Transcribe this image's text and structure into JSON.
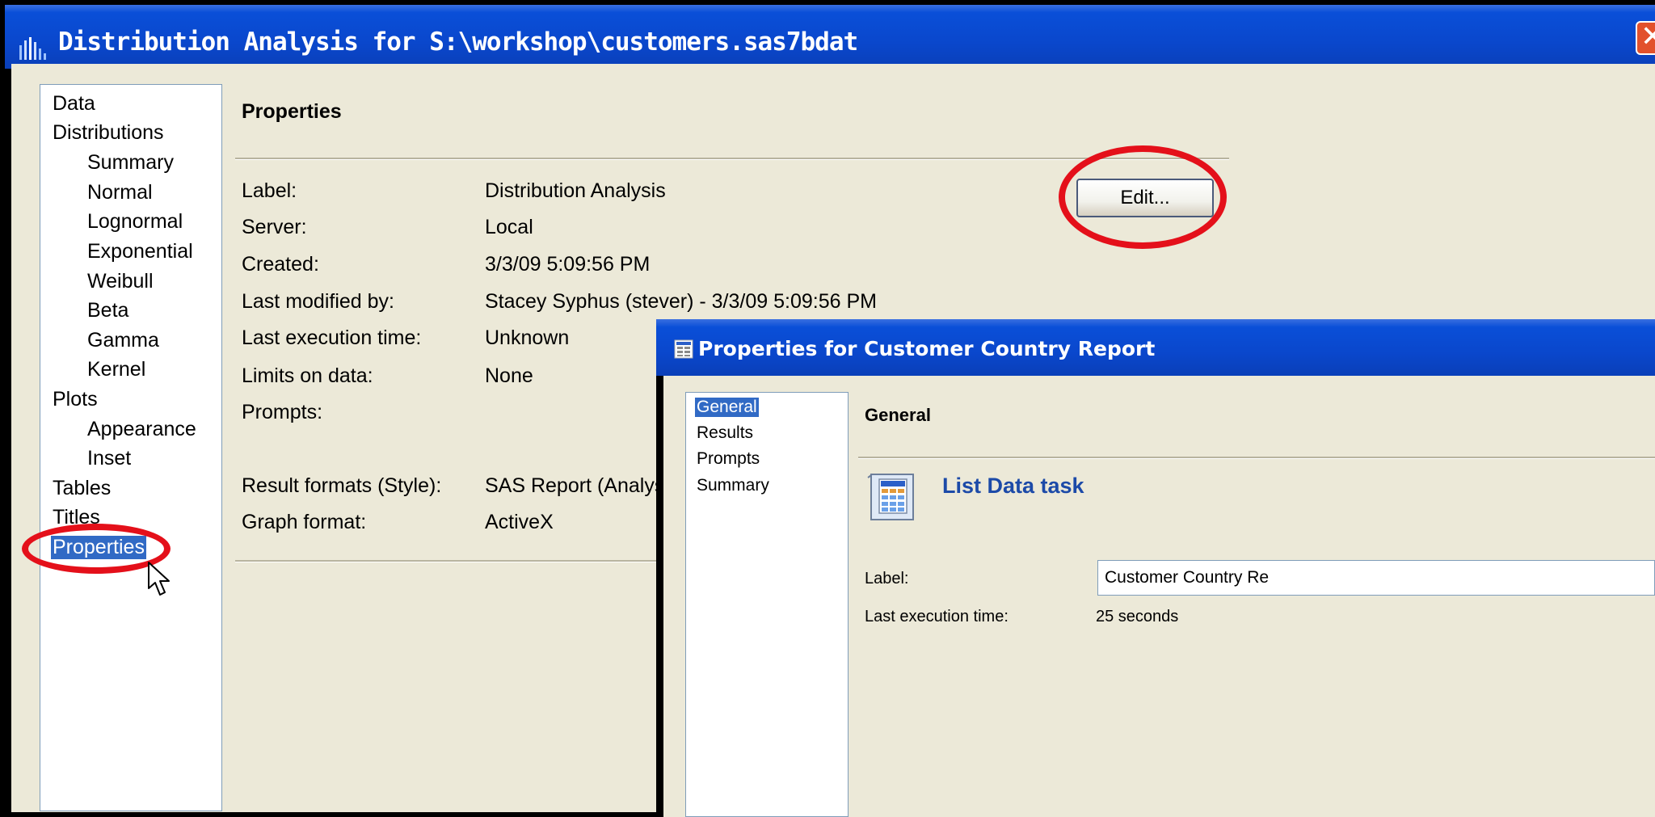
{
  "main_window": {
    "title": "Distribution Analysis for S:\\workshop\\customers.sas7bdat",
    "close_symbol": "✕",
    "nav": {
      "items": [
        {
          "label": "Data",
          "indent": 0
        },
        {
          "label": "Distributions",
          "indent": 0
        },
        {
          "label": "Summary",
          "indent": 1
        },
        {
          "label": "Normal",
          "indent": 1
        },
        {
          "label": "Lognormal",
          "indent": 1
        },
        {
          "label": "Exponential",
          "indent": 1
        },
        {
          "label": "Weibull",
          "indent": 1
        },
        {
          "label": "Beta",
          "indent": 1
        },
        {
          "label": "Gamma",
          "indent": 1
        },
        {
          "label": "Kernel",
          "indent": 1
        },
        {
          "label": "Plots",
          "indent": 0
        },
        {
          "label": "Appearance",
          "indent": 1
        },
        {
          "label": "Inset",
          "indent": 1
        },
        {
          "label": "Tables",
          "indent": 0
        },
        {
          "label": "Titles",
          "indent": 0
        },
        {
          "label": "Properties",
          "indent": 0,
          "selected": true
        }
      ]
    },
    "panel": {
      "heading": "Properties",
      "edit_button": "Edit...",
      "rows": [
        {
          "label": "Label:",
          "value": "Distribution Analysis"
        },
        {
          "label": "Server:",
          "value": "Local"
        },
        {
          "label": "Created:",
          "value": "3/3/09 5:09:56 PM"
        },
        {
          "label": "Last modified by:",
          "value": "Stacey Syphus (stever) - 3/3/09 5:09:56 PM"
        },
        {
          "label": "Last execution time:",
          "value": "Unknown"
        },
        {
          "label": "Limits on data:",
          "value": "None"
        },
        {
          "label": "Prompts:",
          "value": ""
        },
        {
          "label": "Result formats (Style):",
          "value": "SAS Report (Analys"
        },
        {
          "label": "Graph format:",
          "value": "ActiveX"
        }
      ]
    }
  },
  "second_window": {
    "title": "Properties for Customer Country Report",
    "nav": {
      "items": [
        {
          "label": "General",
          "selected": true
        },
        {
          "label": "Results"
        },
        {
          "label": "Prompts"
        },
        {
          "label": "Summary"
        }
      ]
    },
    "heading": "General",
    "task_title": "List Data task",
    "fields": {
      "label_label": "Label:",
      "label_value": "Customer Country Re",
      "exec_label": "Last execution time:",
      "exec_value": "25 seconds"
    }
  },
  "annotations": {
    "highlight_color": "#e4101a"
  },
  "colors": {
    "titlebar": "#0a47cc",
    "selection": "#316ac5",
    "dialog_bg": "#ece9d8",
    "task_title": "#1c4aa8"
  }
}
